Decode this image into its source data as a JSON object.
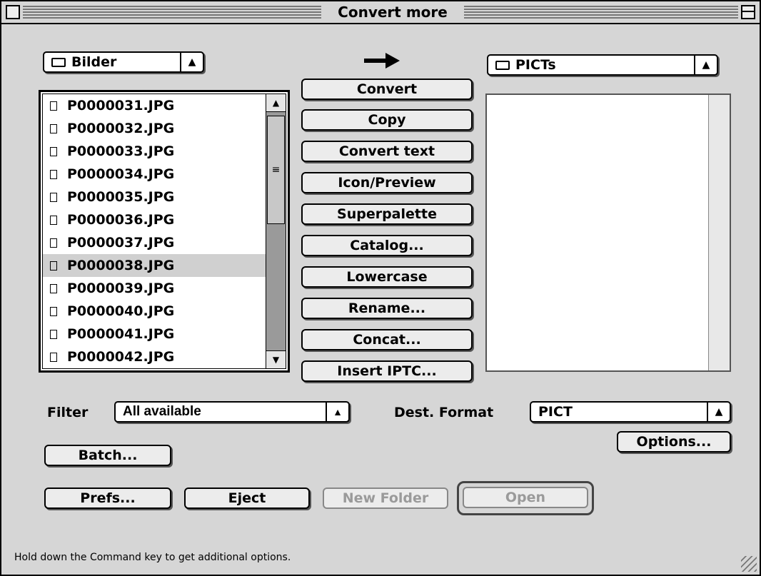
{
  "window": {
    "title": "Convert more"
  },
  "source": {
    "folder": "Bilder",
    "files": [
      "P0000031.JPG",
      "P0000032.JPG",
      "P0000033.JPG",
      "P0000034.JPG",
      "P0000035.JPG",
      "P0000036.JPG",
      "P0000037.JPG",
      "P0000038.JPG",
      "P0000039.JPG",
      "P0000040.JPG",
      "P0000041.JPG",
      "P0000042.JPG"
    ],
    "selected_index": 7
  },
  "dest": {
    "folder": "PICTs"
  },
  "actions": {
    "convert": "Convert",
    "copy": "Copy",
    "convert_text": "Convert text",
    "icon_preview": "Icon/Preview",
    "superpalette": "Superpalette",
    "catalog": "Catalog...",
    "lowercase": "Lowercase",
    "rename": "Rename...",
    "concat": "Concat...",
    "insert_iptc": "Insert IPTC..."
  },
  "filter": {
    "label": "Filter",
    "value": "All available"
  },
  "dest_format": {
    "label": "Dest. Format",
    "value": "PICT"
  },
  "buttons": {
    "options": "Options...",
    "batch": "Batch...",
    "prefs": "Prefs...",
    "eject": "Eject",
    "new_folder": "New Folder",
    "open": "Open"
  },
  "status": "Hold down the Command key to get additional options.",
  "icons": {
    "arrow": "right-arrow-icon",
    "folder": "folder-icon",
    "file": "document-icon"
  }
}
